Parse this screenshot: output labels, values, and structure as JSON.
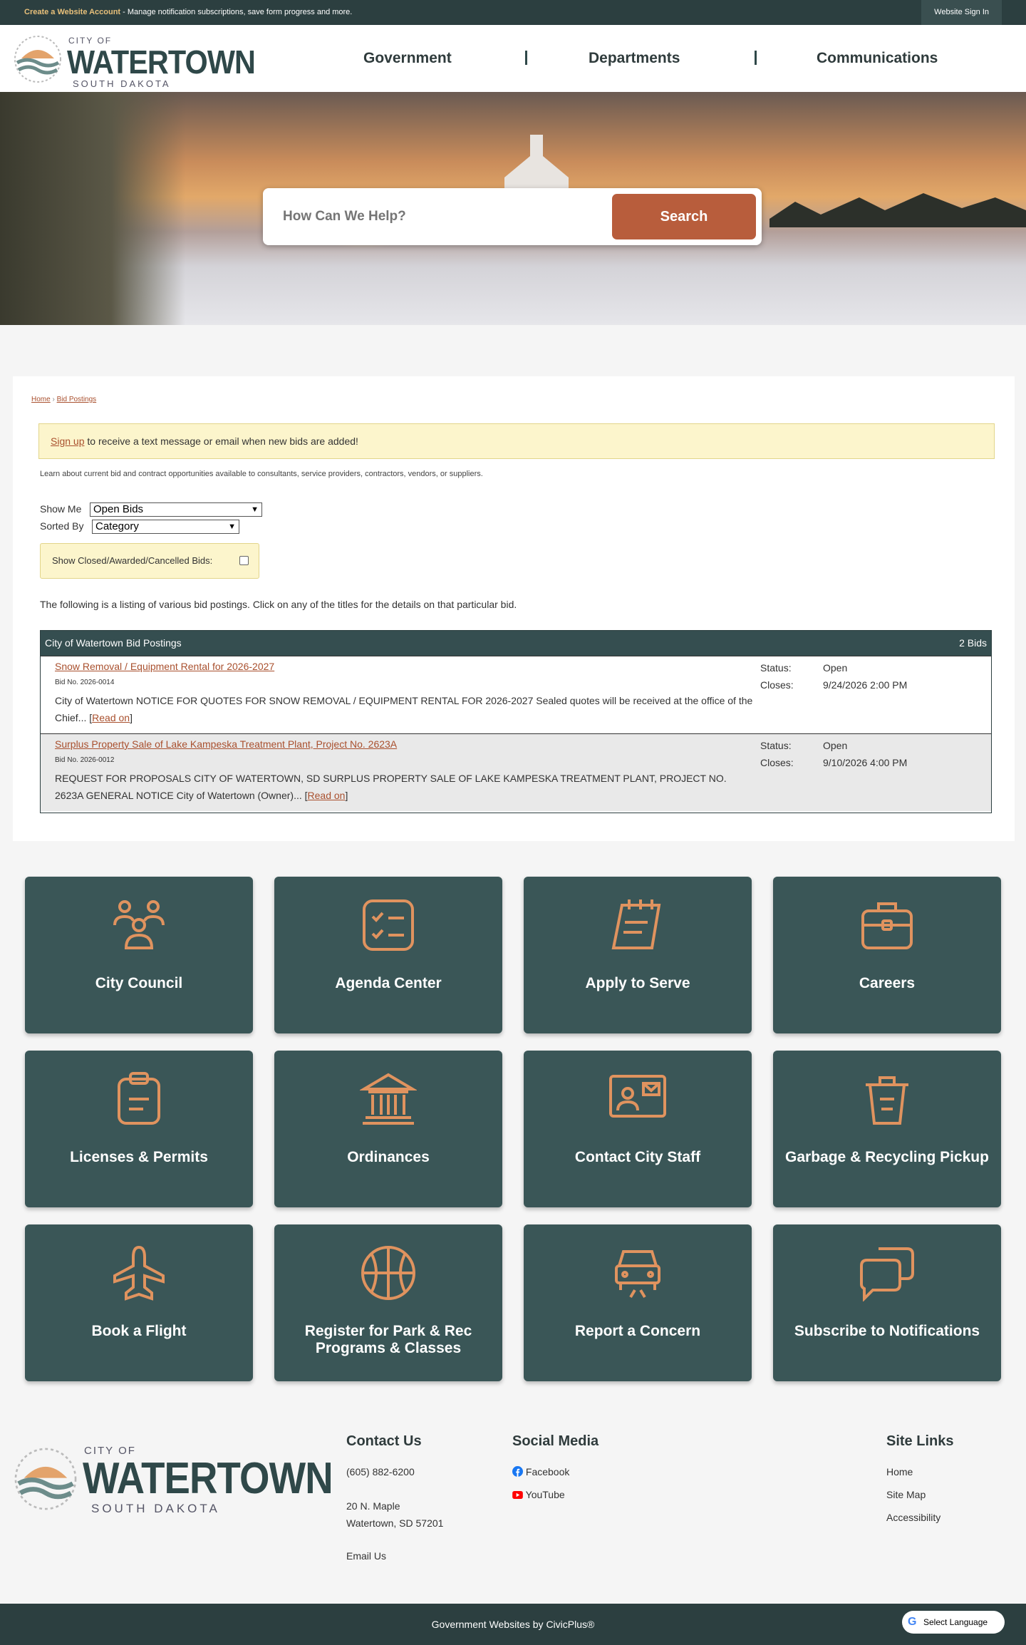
{
  "topbar": {
    "create_link": "Create a Website Account",
    "message": " - Manage notification subscriptions, save form progress and more.",
    "signin": "Website Sign In"
  },
  "logo": {
    "city": "CITY OF",
    "name": "WATERTOWN",
    "state": "SOUTH DAKOTA"
  },
  "nav": [
    {
      "label": "Government"
    },
    {
      "label": "Departments"
    },
    {
      "label": "Communications"
    }
  ],
  "search": {
    "placeholder": "How Can We Help?",
    "button": "Search"
  },
  "breadcrumb": {
    "home": "Home",
    "current": "Bid Postings",
    "sep": "›"
  },
  "alert": {
    "link": "Sign up",
    "text": " to receive a text message or email when new bids are added!"
  },
  "intro": "Learn about current bid and contract opportunities available to consultants, service providers, contractors, vendors, or suppliers.",
  "filters": {
    "show_me_label": "Show Me",
    "show_me_value": "Open Bids",
    "sorted_by_label": "Sorted By",
    "sorted_by_value": "Category",
    "closed_label": "Show Closed/Awarded/Cancelled Bids:"
  },
  "listing_text": "The following is a listing of various bid postings. Click on any of the titles for the details on that particular bid.",
  "bids": {
    "title": "City of Watertown Bid Postings",
    "count": "2 Bids",
    "status_label": "Status:",
    "closes_label": "Closes:",
    "read_on": "Read on",
    "rows": [
      {
        "title": "Snow Removal / Equipment Rental for 2026-2027",
        "no": "Bid No. 2026-0014",
        "desc": "City of Watertown NOTICE FOR QUOTES FOR SNOW REMOVAL / EQUIPMENT RENTAL FOR 2026-2027 Sealed quotes will be received at the office of the Chief...",
        "status": "Open",
        "closes": "9/24/2026 2:00 PM"
      },
      {
        "title": "Surplus Property Sale of Lake Kampeska Treatment Plant, Project No. 2623A",
        "no": "Bid No. 2026-0012",
        "desc": "REQUEST FOR PROPOSALS CITY OF WATERTOWN, SD SURPLUS PROPERTY SALE OF LAKE KAMPESKA TREATMENT PLANT, PROJECT NO. 2623A GENERAL NOTICE City of Watertown (Owner)...",
        "status": "Open",
        "closes": "9/10/2026 4:00 PM"
      }
    ]
  },
  "tiles": [
    {
      "label": "City Council",
      "icon": "people-icon"
    },
    {
      "label": "Agenda Center",
      "icon": "checklist-icon"
    },
    {
      "label": "Apply to Serve",
      "icon": "notepad-icon"
    },
    {
      "label": "Careers",
      "icon": "briefcase-icon"
    },
    {
      "label": "Licenses & Permits",
      "icon": "clipboard-icon"
    },
    {
      "label": "Ordinances",
      "icon": "building-icon"
    },
    {
      "label": "Contact City Staff",
      "icon": "contact-card-icon"
    },
    {
      "label": "Garbage & Recycling Pickup",
      "icon": "trash-icon"
    },
    {
      "label": "Book a Flight",
      "icon": "airplane-icon"
    },
    {
      "label": "Register for Park & Rec Programs & Classes",
      "icon": "basketball-icon"
    },
    {
      "label": "Report a Concern",
      "icon": "car-icon"
    },
    {
      "label": "Subscribe to Notifications",
      "icon": "chat-icon"
    }
  ],
  "footer": {
    "contact_title": "Contact Us",
    "phone": "(605) 882-6200",
    "address1": "20 N. Maple",
    "address2": "Watertown, SD 57201",
    "email": "Email Us",
    "social_title": "Social Media",
    "facebook": "Facebook",
    "youtube": "YouTube",
    "links_title": "Site Links",
    "home": "Home",
    "sitemap": "Site Map",
    "accessibility": "Accessibility"
  },
  "bottombar": {
    "text": "Government Websites by CivicPlus®",
    "lang": "Select Language"
  },
  "colors": {
    "accent": "#b85d3c",
    "tile": "#3a5657",
    "icon": "#e0935f",
    "dark": "#2c3f40"
  }
}
